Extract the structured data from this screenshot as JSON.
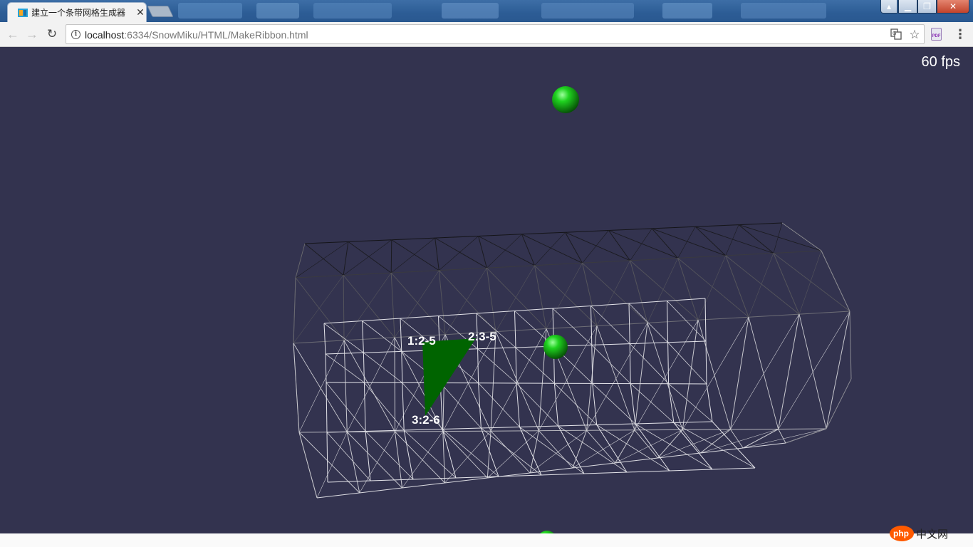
{
  "browser": {
    "tab": {
      "title": "建立一个条带网格生成器"
    },
    "toolbar": {
      "url_host": "localhost",
      "url_rest": ":6334/SnowMiku/HTML/MakeRibbon.html"
    }
  },
  "scene": {
    "fps_text": "60 fps",
    "vertex_labels": [
      "1:2-5",
      "2:3-5",
      "3:2-6"
    ],
    "colors": {
      "background": "#33334f",
      "sphere": "#1fd21f",
      "triangle": "#006400"
    }
  },
  "watermark": {
    "php": "php",
    "cn": "中文网"
  }
}
